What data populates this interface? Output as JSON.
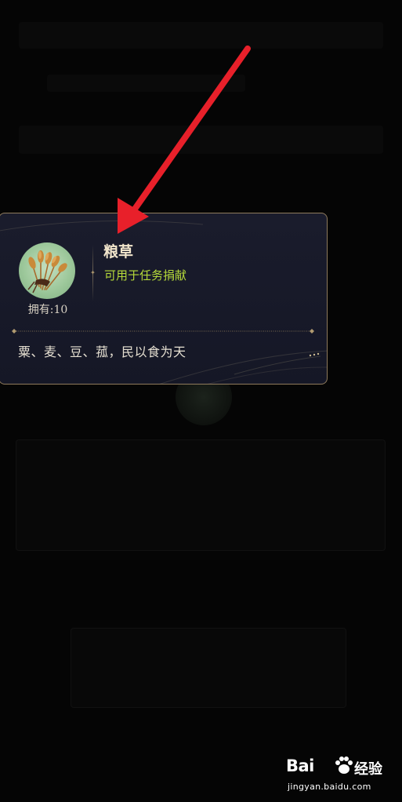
{
  "item": {
    "name": "粮草",
    "usage": "可用于任务捐献",
    "owned": "拥有:10",
    "description": "粟、麦、豆、菰，民以食为天",
    "icon": "wheat-bundle-icon"
  },
  "watermark": {
    "logo": "Bai",
    "brand": "经验",
    "url": "jingyan.baidu.com"
  },
  "colors": {
    "card_bg": "#171a2a",
    "card_border": "#8f7b5c",
    "name": "#f2e6cc",
    "usage": "#b5d93a",
    "arrow": "#e8202a"
  }
}
